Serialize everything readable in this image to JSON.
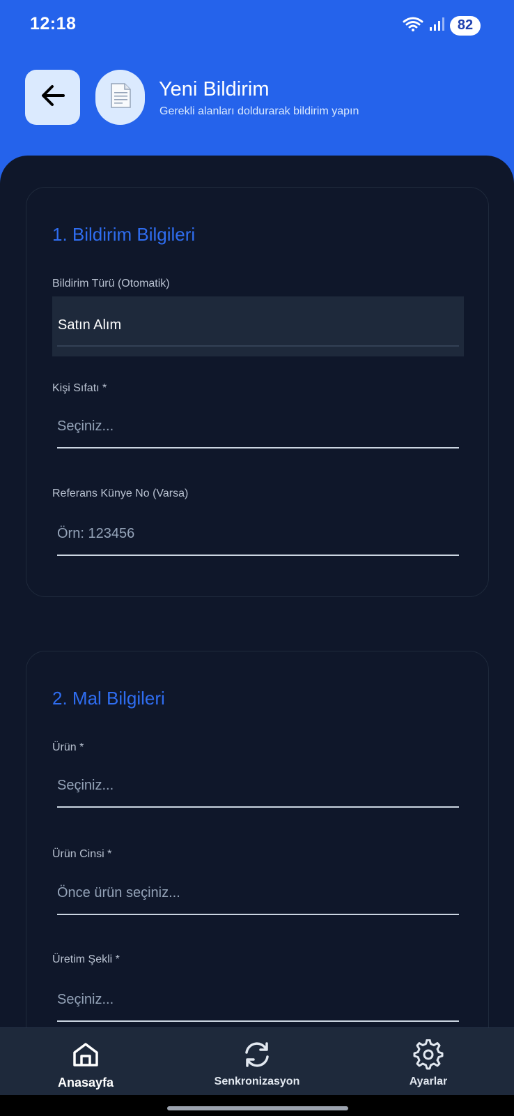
{
  "status_bar": {
    "time": "12:18",
    "battery": "82",
    "wifi_icon": "wifi-icon",
    "signal_icon": "signal-icon"
  },
  "header": {
    "title": "Yeni Bildirim",
    "subtitle": "Gerekli alanları doldurarak bildirim yapın",
    "back_icon": "arrow-left-icon",
    "doc_icon": "document-icon",
    "accent_color": "#2563eb"
  },
  "sections": [
    {
      "title": "1. Bildirim Bilgileri",
      "fields": [
        {
          "label": "Bildirim Türü (Otomatik)",
          "value": "Satın Alım",
          "readonly": true
        },
        {
          "label": "Kişi Sıfatı *",
          "placeholder": "Seçiniz..."
        },
        {
          "label": "Referans Künye No (Varsa)",
          "placeholder": "Örn: 123456"
        }
      ]
    },
    {
      "title": "2. Mal Bilgileri",
      "fields": [
        {
          "label": "Ürün *",
          "placeholder": "Seçiniz..."
        },
        {
          "label": "Ürün Cinsi *",
          "placeholder": "Önce ürün seçiniz..."
        },
        {
          "label": "Üretim Şekli *",
          "placeholder": "Seçiniz..."
        }
      ]
    }
  ],
  "bottom_nav": [
    {
      "label": "Anasayfa",
      "icon": "home-icon",
      "active": true
    },
    {
      "label": "Senkronizasyon",
      "icon": "sync-icon",
      "active": false
    },
    {
      "label": "Ayarlar",
      "icon": "gear-icon",
      "active": false
    }
  ]
}
